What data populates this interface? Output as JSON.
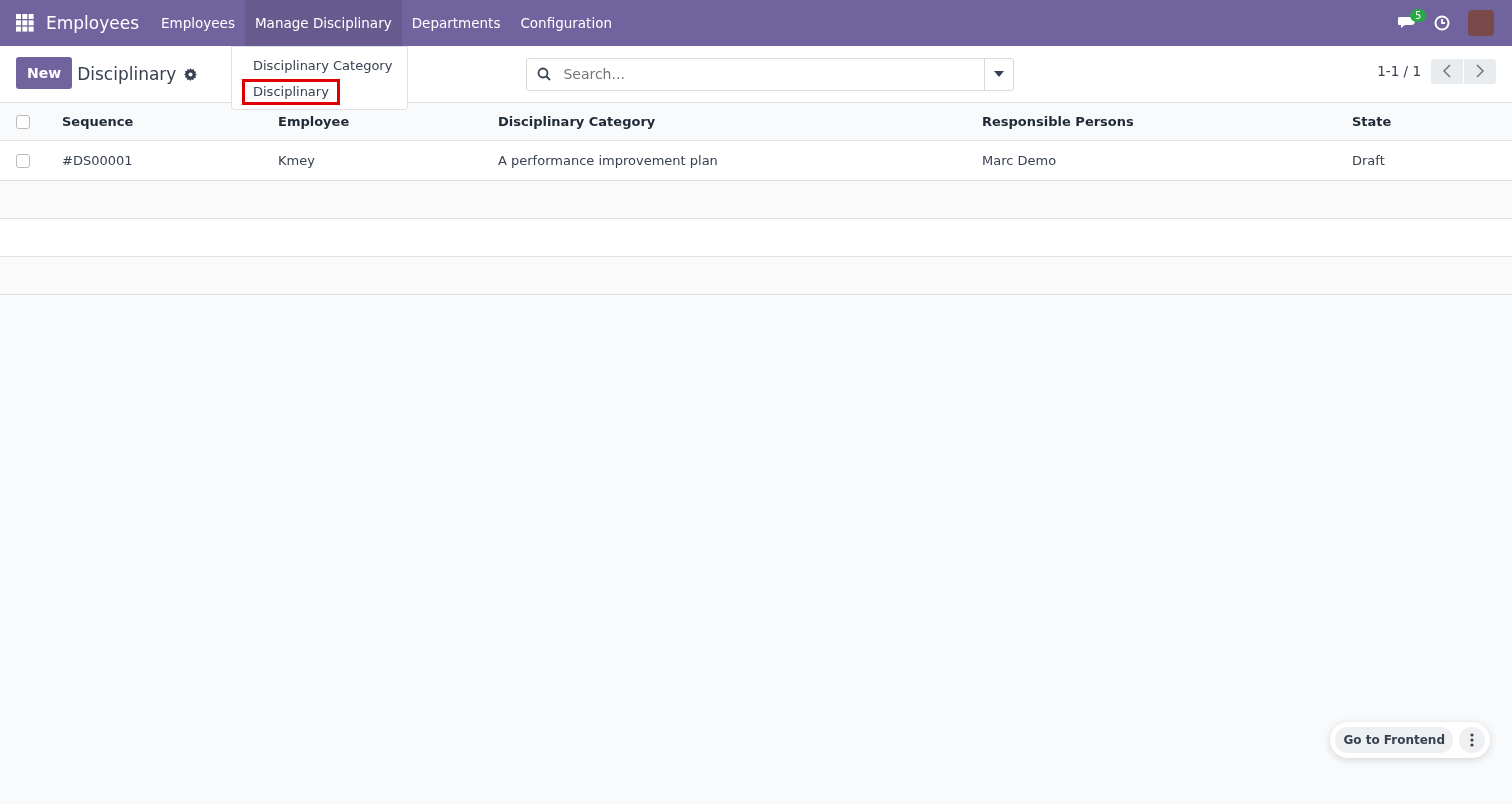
{
  "navbar": {
    "app_title": "Employees",
    "menu": [
      {
        "label": "Employees",
        "selected": false
      },
      {
        "label": "Manage Disciplinary",
        "selected": true
      },
      {
        "label": "Departments",
        "selected": false
      },
      {
        "label": "Configuration",
        "selected": false
      }
    ],
    "message_count": "5"
  },
  "dropdown": {
    "items": [
      {
        "label": "Disciplinary Category",
        "highlighted": false
      },
      {
        "label": "Disciplinary",
        "highlighted": true
      }
    ]
  },
  "control_panel": {
    "new_button": "New",
    "title": "Disciplinary",
    "search": {
      "placeholder": "Search..."
    },
    "pager": "1-1 / 1"
  },
  "table": {
    "columns": [
      "Sequence",
      "Employee",
      "Disciplinary Category",
      "Responsible Persons",
      "State"
    ],
    "all_checked": false,
    "rows": [
      {
        "checked": false,
        "cells": [
          "#DS00001",
          "Kmey",
          "A performance improvement plan",
          "Marc Demo",
          "Draft"
        ]
      }
    ]
  },
  "floating": {
    "button": "Go to Frontend"
  }
}
